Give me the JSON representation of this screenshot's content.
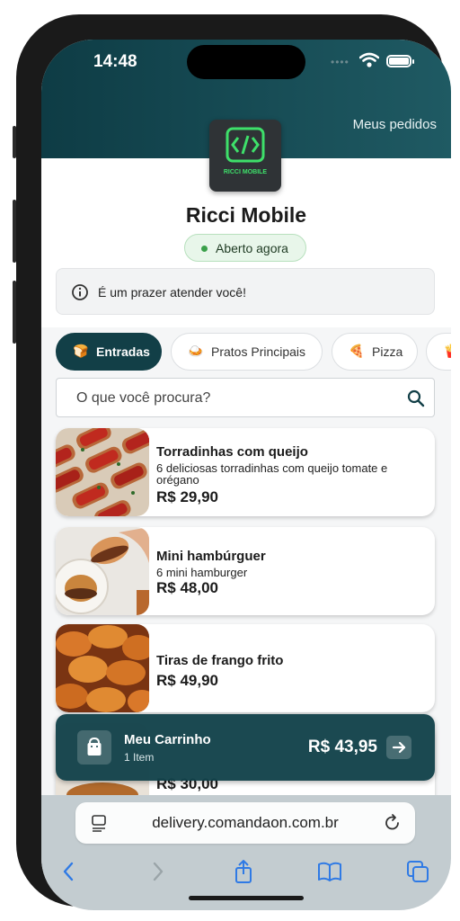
{
  "status_bar": {
    "time": "14:48",
    "signal_dots": "••••"
  },
  "header": {
    "my_orders_label": "Meus pedidos"
  },
  "store": {
    "logo_text": "RICCI MOBILE",
    "name": "Ricci Mobile",
    "status": "Aberto agora",
    "welcome_message": "É um prazer atender você!"
  },
  "categories": [
    {
      "label": "Entradas",
      "icon": "🍞",
      "active": true
    },
    {
      "label": "Pratos Principais",
      "icon": "🍛",
      "active": false
    },
    {
      "label": "Pizza",
      "icon": "🍕",
      "active": false
    },
    {
      "label": "",
      "icon": "🍟",
      "active": false
    }
  ],
  "search": {
    "placeholder": "O que você procura?"
  },
  "products": [
    {
      "name": "Torradinhas com queijo",
      "description": "6 deliciosas torradinhas com queijo tomate e orégano",
      "price": "R$ 29,90"
    },
    {
      "name": "Mini hambúrguer",
      "description": "6 mini hamburger",
      "price": "R$ 48,00"
    },
    {
      "name": "Tiras de frango frito",
      "description": "",
      "price": "R$ 49,90"
    },
    {
      "name": "",
      "description": "",
      "price": "R$ 30,00"
    }
  ],
  "cart": {
    "title": "Meu Carrinho",
    "items": "1 Item",
    "total": "R$ 43,95"
  },
  "browser": {
    "url": "delivery.comandaon.com.br"
  },
  "colors": {
    "primary": "#123f47",
    "header": "#1f5a63",
    "open_green": "#3aa04a",
    "logo_green": "#3ee06a"
  }
}
